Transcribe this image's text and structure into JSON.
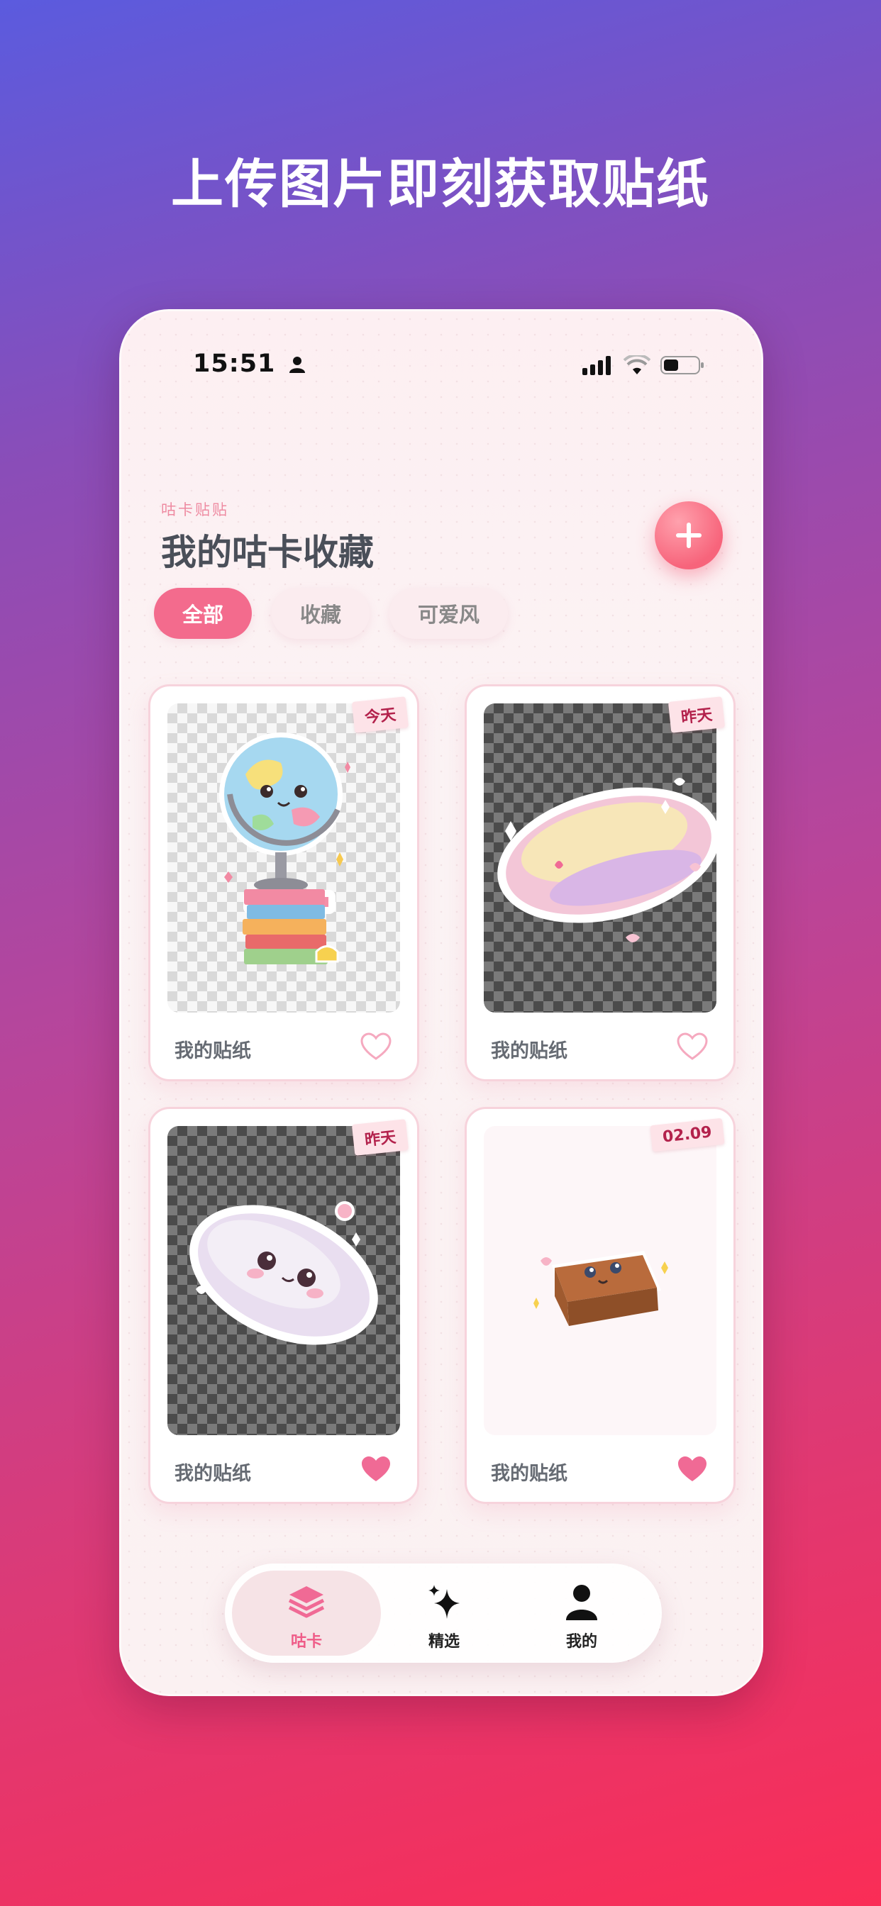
{
  "headline": "上传图片即刻获取贴纸",
  "status_bar": {
    "time": "15:51"
  },
  "header": {
    "subtitle": "咕卡贴贴",
    "title": "我的咕卡收藏"
  },
  "filters": [
    {
      "label": "全部",
      "active": true
    },
    {
      "label": "收藏",
      "active": false
    },
    {
      "label": "可爱风",
      "active": false
    }
  ],
  "cards": [
    {
      "tag": "今天",
      "label": "我的贴纸",
      "favorited": false,
      "background": "checker-light",
      "sticker": "globe-with-books"
    },
    {
      "tag": "昨天",
      "label": "我的贴纸",
      "favorited": false,
      "background": "checker-dark",
      "sticker": "pink-mouse"
    },
    {
      "tag": "昨天",
      "label": "我的贴纸",
      "favorited": true,
      "background": "checker-dark",
      "sticker": "cute-mouse-face"
    },
    {
      "tag": "02.09",
      "label": "我的贴纸",
      "favorited": true,
      "background": "plain",
      "sticker": "wooden-block"
    }
  ],
  "tabbar": [
    {
      "label": "咕卡",
      "icon": "layers-icon",
      "active": true
    },
    {
      "label": "精选",
      "icon": "sparkle-icon",
      "active": false
    },
    {
      "label": "我的",
      "icon": "person-icon",
      "active": false
    }
  ],
  "colors": {
    "accent": "#f36b8d",
    "heart": "#f06a95",
    "title": "#4a4f59"
  }
}
